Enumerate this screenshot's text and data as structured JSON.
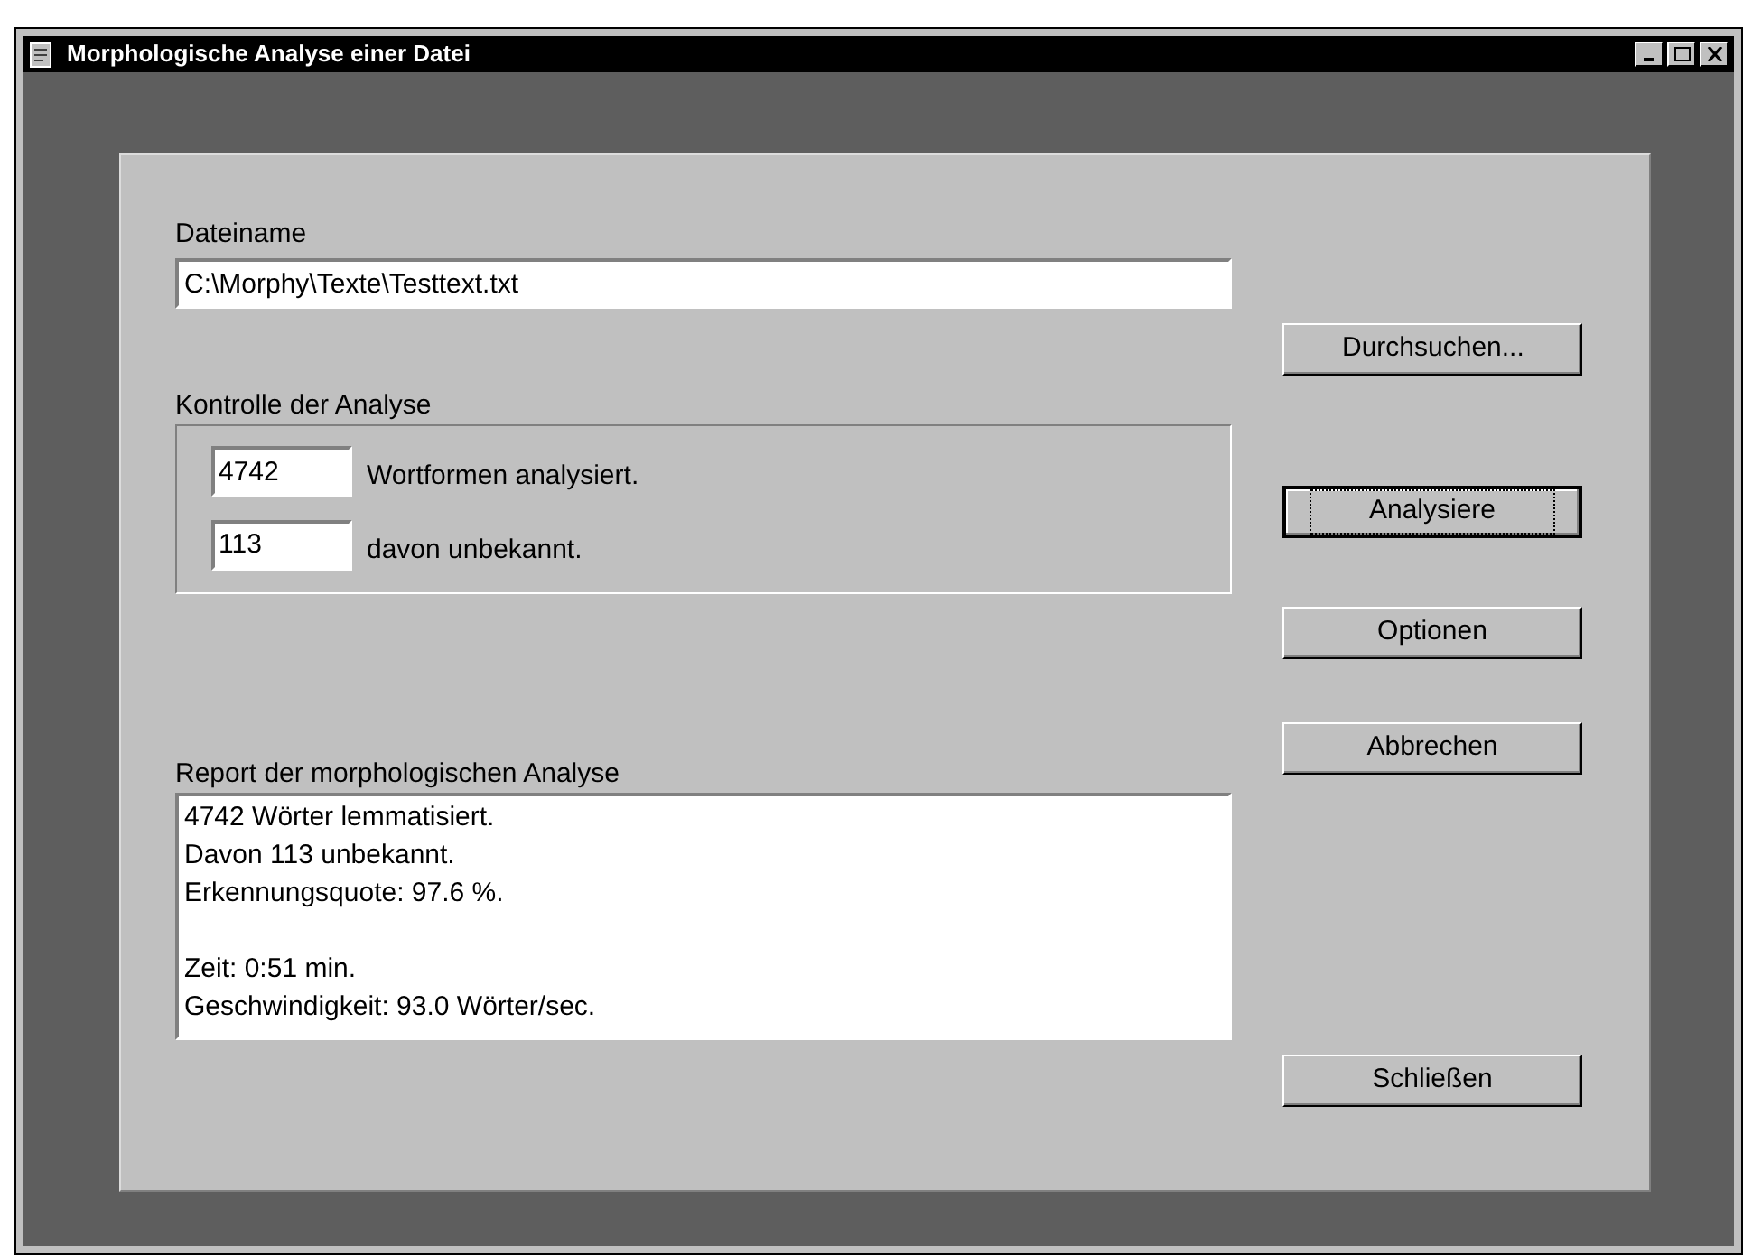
{
  "window": {
    "title": "Morphologische Analyse einer Datei"
  },
  "file": {
    "label": "Dateiname",
    "value": "C:\\Morphy\\Texte\\Testtext.txt"
  },
  "control": {
    "label": "Kontrolle der Analyse",
    "rows": [
      {
        "value": "4742",
        "label": "Wortformen analysiert."
      },
      {
        "value": "113",
        "label": "davon unbekannt."
      }
    ]
  },
  "report": {
    "label": "Report der morphologischen Analyse",
    "paragraphs": [
      {
        "lines": [
          "4742 Wörter lemmatisiert.",
          "Davon 113 unbekannt.",
          "Erkennungsquote: 97.6 %."
        ]
      },
      {
        "lines": [
          "Zeit: 0:51 min.",
          "Geschwindigkeit: 93.0 Wörter/sec."
        ]
      }
    ]
  },
  "buttons": [
    {
      "label": "Durchsuchen...",
      "default": false
    },
    {
      "label": "Analysiere",
      "default": true
    },
    {
      "label": "Optionen",
      "default": false
    },
    {
      "label": "Abbrechen",
      "default": false
    },
    {
      "label": "Schließen",
      "default": false
    }
  ]
}
